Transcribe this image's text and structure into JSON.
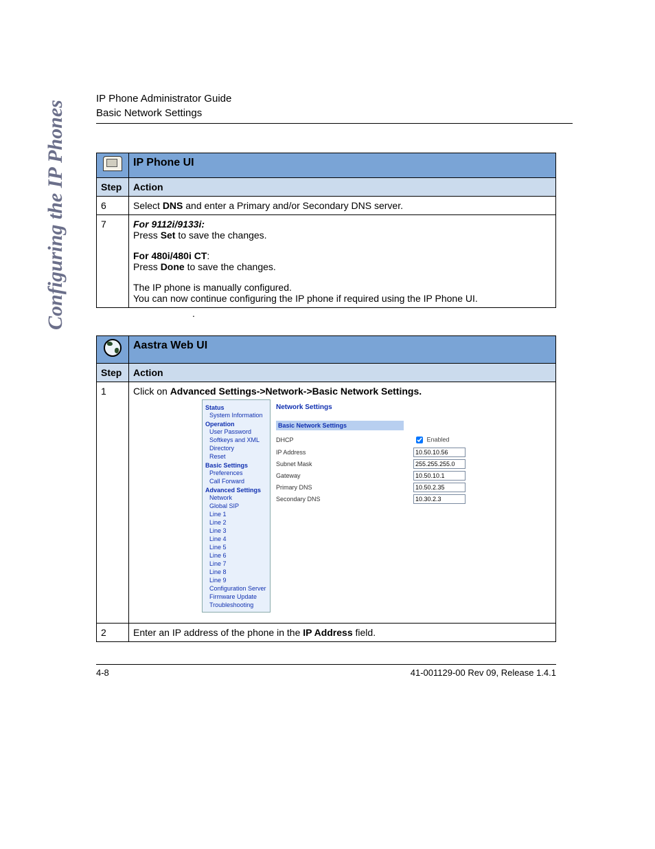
{
  "header": {
    "line1": "IP Phone Administrator Guide",
    "line2": "Basic Network Settings"
  },
  "side_text": "Configuring the IP Phones",
  "section1": {
    "title": "IP Phone UI",
    "col_step": "Step",
    "col_action": "Action",
    "rows": [
      {
        "step": "6",
        "prefix": "Select ",
        "bold1": "DNS",
        "suffix": " and enter a Primary and/or Secondary DNS server."
      },
      {
        "step": "7",
        "l1_italic": "For 9112i/9133i:",
        "l2a": "Press ",
        "l2b": "Set",
        "l2c": " to save the changes.",
        "l3_bold": "For 480i/480i CT",
        "l3_colon": ":",
        "l4a": "Press ",
        "l4b": "Done",
        "l4c": " to save the changes.",
        "l5": "The IP phone is manually configured.",
        "l6": "You can now continue configuring the IP phone if required using the IP Phone UI."
      }
    ]
  },
  "between_dot": ".",
  "section2": {
    "title": "Aastra Web UI",
    "col_step": "Step",
    "col_action": "Action",
    "row1": {
      "step": "1",
      "prefix": "Click on ",
      "bold": "Advanced Settings->Network->Basic Network Settings."
    },
    "row2": {
      "step": "2",
      "prefix": "Enter an IP address of the phone in the ",
      "bold": "IP Address",
      "suffix": " field."
    }
  },
  "webui": {
    "nav": {
      "status": "Status",
      "status_items": [
        "System Information"
      ],
      "operation": "Operation",
      "operation_items": [
        "User Password",
        "Softkeys and XML",
        "Directory",
        "Reset"
      ],
      "basic": "Basic Settings",
      "basic_items": [
        "Preferences",
        "Call Forward"
      ],
      "advanced": "Advanced Settings",
      "advanced_items": [
        "Network",
        "Global SIP",
        "Line 1",
        "Line 2",
        "Line 3",
        "Line 4",
        "Line 5",
        "Line 6",
        "Line 7",
        "Line 8",
        "Line 9",
        "Configuration Server",
        "Firmware Update",
        "Troubleshooting"
      ]
    },
    "panel": {
      "heading": "Network Settings",
      "section": "Basic Network Settings",
      "rows": {
        "dhcp": "DHCP",
        "dhcp_enabled": "Enabled",
        "ip": "IP Address",
        "ip_val": "10.50.10.56",
        "subnet": "Subnet Mask",
        "subnet_val": "255.255.255.0",
        "gateway": "Gateway",
        "gateway_val": "10.50.10.1",
        "pdns": "Primary DNS",
        "pdns_val": "10.50.2.35",
        "sdns": "Secondary DNS",
        "sdns_val": "10.30.2.3"
      }
    }
  },
  "footer": {
    "left": "4-8",
    "right": "41-001129-00 Rev 09, Release 1.4.1"
  }
}
